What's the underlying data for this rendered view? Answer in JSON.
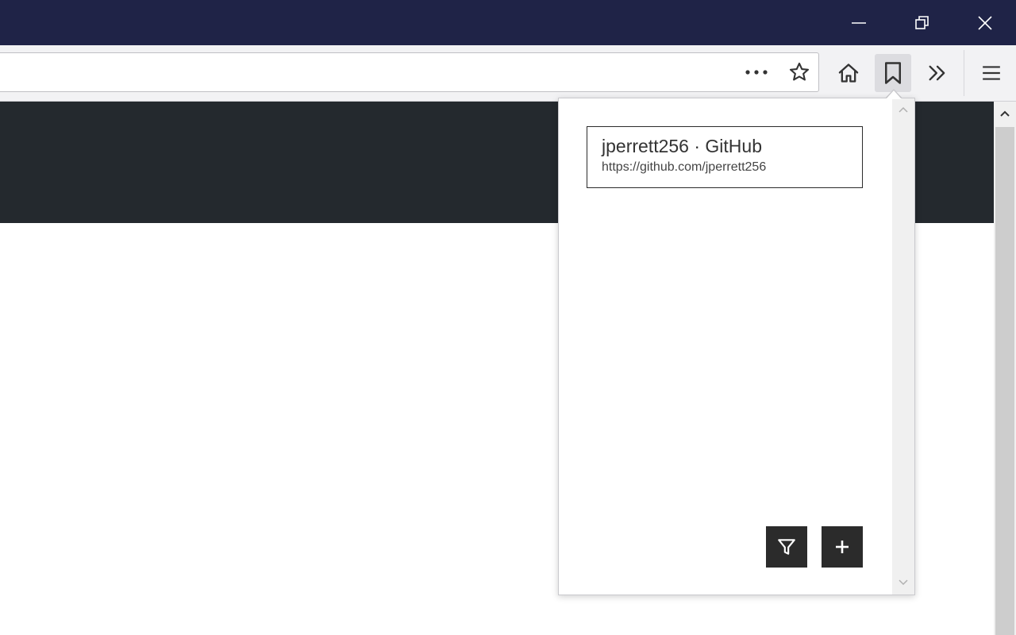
{
  "window": {
    "controls": {
      "minimize_icon": "minimize-icon",
      "restore_icon": "restore-icon",
      "close_icon": "close-icon"
    },
    "colors": {
      "titlebar": "#1f2347",
      "toolbar": "#f2f2f4"
    }
  },
  "toolbar": {
    "url_value": "",
    "page_actions_icon": "more-horizontal-icon",
    "bookmark_star_icon": "star-icon",
    "home_icon": "home-icon",
    "bookmarks_icon": "bookmark-icon",
    "overflow_icon": "double-chevron-right-icon",
    "menu_icon": "hamburger-icon"
  },
  "page": {
    "banner_color": "#24292e"
  },
  "popup": {
    "bookmarks": [
      {
        "title": "jperrett256 · GitHub",
        "url": "https://github.com/jperrett256"
      }
    ],
    "filter_icon": "filter-icon",
    "add_icon": "plus-icon"
  }
}
